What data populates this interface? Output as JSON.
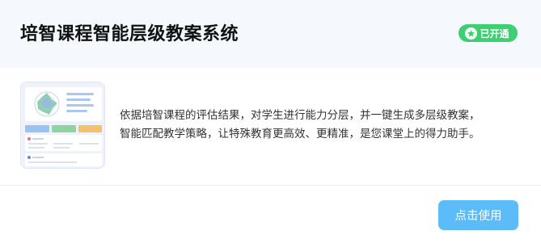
{
  "card": {
    "title": "培智课程智能层级教案系统",
    "status_badge": {
      "label": "已开通",
      "icon": "star-icon",
      "color": "#3ecf73"
    },
    "description": "依据培智课程的评估结果，对学生进行能力分层，并一键生成多层级教案，\n智能匹配教学策略，让特殊教育更高效、更精准，是您课堂上的得力助手。",
    "action_button": {
      "label": "点击使用",
      "color": "#5bbcf8"
    }
  }
}
